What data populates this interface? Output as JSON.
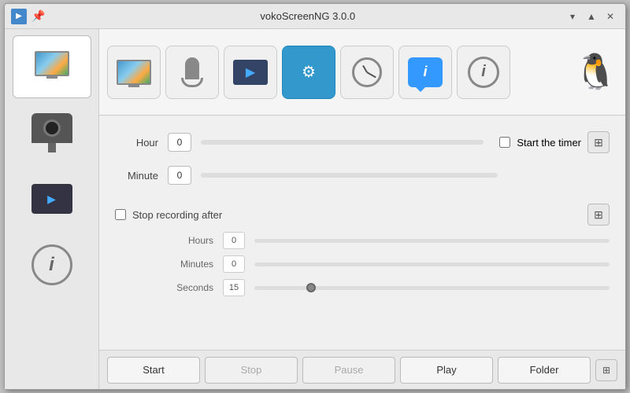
{
  "window": {
    "title": "vokoScreenNG 3.0.0",
    "pin_icon": "📌",
    "controls": {
      "dropdown_label": "▾",
      "minimize_label": "▲",
      "close_label": "✕"
    }
  },
  "toolbar": {
    "buttons": [
      {
        "id": "screen",
        "label": "screen"
      },
      {
        "id": "audio",
        "label": "audio"
      },
      {
        "id": "player",
        "label": "player"
      },
      {
        "id": "settings",
        "label": "settings"
      },
      {
        "id": "timer",
        "label": "timer"
      },
      {
        "id": "chat",
        "label": "chat-active"
      },
      {
        "id": "info",
        "label": "info"
      }
    ],
    "tux_icon": "🐧"
  },
  "sidebar": {
    "items": [
      {
        "id": "screen-capture",
        "label": "Screen capture",
        "active": true
      },
      {
        "id": "webcam",
        "label": "Webcam"
      },
      {
        "id": "player",
        "label": "Player"
      },
      {
        "id": "info",
        "label": "Info"
      }
    ]
  },
  "timer": {
    "hour_label": "Hour",
    "hour_value": "0",
    "minute_label": "Minute",
    "minute_value": "0",
    "start_timer_label": "Start the timer",
    "info_icon": "⊞"
  },
  "stop_recording": {
    "checkbox_label": "Stop recording after",
    "info_icon": "⊞",
    "hours_label": "Hours",
    "hours_value": "0",
    "minutes_label": "Minutes",
    "minutes_value": "0",
    "seconds_label": "Seconds",
    "seconds_value": "15"
  },
  "bottom_bar": {
    "start_label": "Start",
    "stop_label": "Stop",
    "pause_label": "Pause",
    "play_label": "Play",
    "folder_label": "Folder",
    "info_icon": "⊞"
  }
}
